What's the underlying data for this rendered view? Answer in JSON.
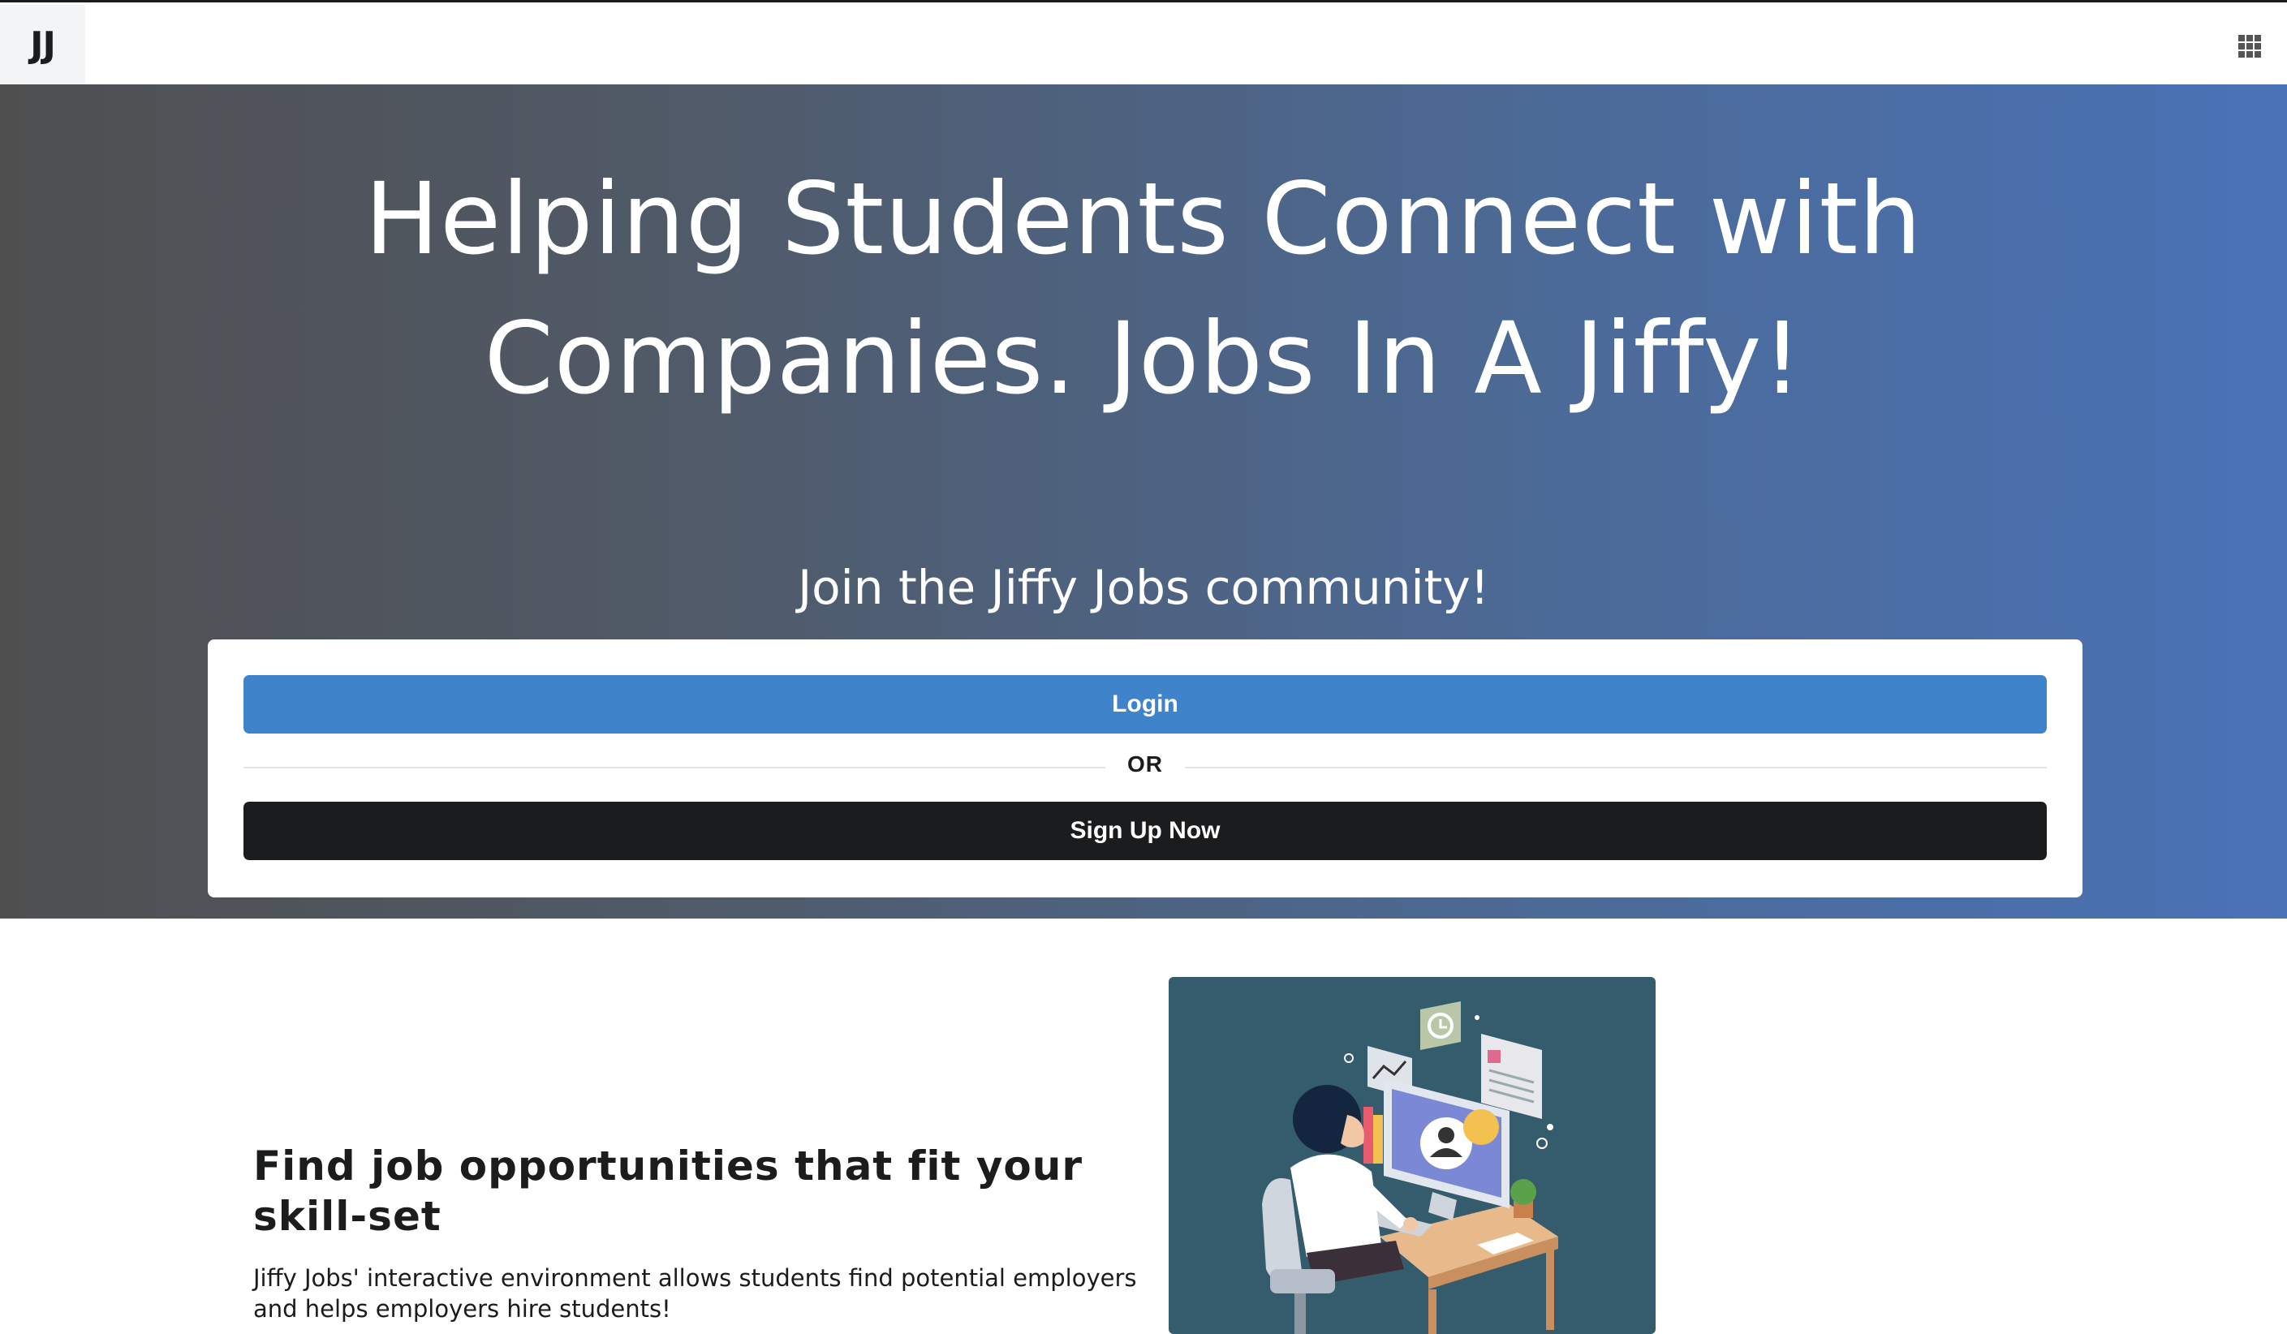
{
  "header": {
    "logo_text": "JJ",
    "menu_icon": "grid-icon"
  },
  "hero": {
    "headline_line1": "Helping Students Connect with",
    "headline_line2": "Companies. Jobs In A Jiffy!",
    "subheadline": "Join the Jiffy Jobs community!",
    "login_label": "Login",
    "divider_label": "OR",
    "signup_label": "Sign Up Now"
  },
  "feature": {
    "title": "Find job opportunities that fit your skill-set",
    "description": "Jiffy Jobs' interactive environment allows students find potential employers and helps employers hire students!"
  },
  "colors": {
    "hero_gradient_start": "#4f4f50",
    "hero_gradient_end": "#4a72b6",
    "login_button": "#3f83cb",
    "signup_button": "#1b1c1d",
    "illustration_bg": "#355c6d"
  }
}
